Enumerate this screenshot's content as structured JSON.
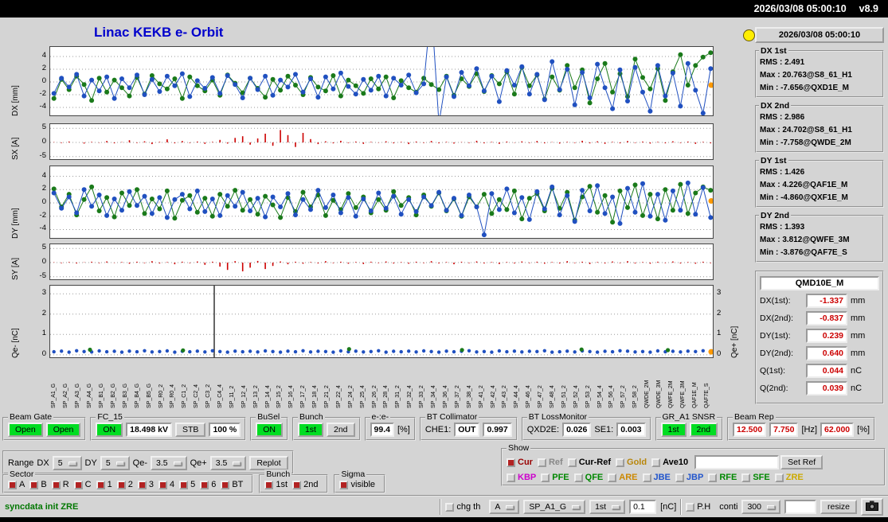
{
  "topbar": {
    "datetime": "2026/03/08 05:00:10",
    "version": "v8.9"
  },
  "header": {
    "title": "Linac KEKB e- Orbit",
    "timestamp": "2026/03/08 05:00:10",
    "lamp_color": "#ffee00"
  },
  "stats_boxes": [
    {
      "title": "DX 1st",
      "lines": [
        "RMS : 2.491",
        "Max : 20.763@S8_61_H1",
        "Min : -7.656@QXD1E_M"
      ]
    },
    {
      "title": "DX 2nd",
      "lines": [
        "RMS : 2.986",
        "Max : 24.702@S8_61_H1",
        "Min : -7.758@QWDE_2M"
      ]
    },
    {
      "title": "DY 1st",
      "lines": [
        "RMS : 1.426",
        "Max : 4.226@QAF1E_M",
        "Min : -4.860@QXF1E_M"
      ]
    },
    {
      "title": "DY 2nd",
      "lines": [
        "RMS : 1.393",
        "Max : 3.812@QWFE_3M",
        "Min : -3.876@QAF7E_S"
      ]
    }
  ],
  "monitor_panel": {
    "title": "QMD10E_M",
    "rows": [
      {
        "label": "DX(1st):",
        "value": "-1.337",
        "unit": "mm"
      },
      {
        "label": "DX(2nd):",
        "value": "-0.837",
        "unit": "mm"
      },
      {
        "label": "DY(1st):",
        "value": "0.239",
        "unit": "mm"
      },
      {
        "label": "DY(2nd):",
        "value": "0.640",
        "unit": "mm"
      },
      {
        "label": "Q(1st):",
        "value": "0.044",
        "unit": "nC"
      },
      {
        "label": "Q(2nd):",
        "value": "0.039",
        "unit": "nC"
      }
    ]
  },
  "panels": {
    "beam_gate": {
      "title": "Beam Gate",
      "open1": "Open",
      "open2": "Open"
    },
    "fc15": {
      "title": "FC_15",
      "on": "ON",
      "kv": "18.498 kV",
      "stb": "STB",
      "pct": "100 %"
    },
    "busel": {
      "title": "BuSel",
      "on": "ON"
    },
    "bunch": {
      "title": "Bunch",
      "b1": "1st",
      "b2": "2nd"
    },
    "ee": {
      "title": "e-:e-",
      "value": "99.4",
      "unit": "[%]"
    },
    "bt_collimator": {
      "title": "BT Collimator",
      "che1_label": "CHE1:",
      "che1": "OUT",
      "value": "0.997"
    },
    "bt_lossmonitor": {
      "title": "BT LossMonitor",
      "qxd2e_label": "QXD2E:",
      "qxd2e": "0.026",
      "se1_label": "SE1:",
      "se1": "0.003"
    },
    "gr_snsr": {
      "title": "GR_A1 SNSR",
      "b1": "1st",
      "b2": "2nd"
    },
    "beam_rep": {
      "title": "Beam Rep",
      "v1": "12.500",
      "v2": "7.750",
      "hz": "[Hz]",
      "v3": "62.000",
      "pct": "[%]"
    }
  },
  "range_row": {
    "label": "Range",
    "dx_label": "DX",
    "dx": "5",
    "dy_label": "DY",
    "dy": "5",
    "qem_label": "Qe-",
    "qem": "3.5",
    "qep_label": "Qe+",
    "qep": "3.5",
    "replot": "Replot"
  },
  "show_panel": {
    "title": "Show",
    "row1": [
      {
        "label": "Cur",
        "checked": true,
        "color": "#990000"
      },
      {
        "label": "Ref",
        "checked": false,
        "color": "#888888"
      },
      {
        "label": "Cur-Ref",
        "checked": false,
        "color": "#000000"
      },
      {
        "label": "Gold",
        "checked": false,
        "color": "#b8860b"
      },
      {
        "label": "Ave10",
        "checked": false,
        "color": "#000000"
      }
    ],
    "set_ref": "Set Ref",
    "row2": [
      {
        "label": "KBP",
        "checked": false,
        "color": "#cc00cc"
      },
      {
        "label": "PFE",
        "checked": false,
        "color": "#008800"
      },
      {
        "label": "QFE",
        "checked": false,
        "color": "#008800"
      },
      {
        "label": "ARE",
        "checked": false,
        "color": "#cc8800"
      },
      {
        "label": "JBE",
        "checked": false,
        "color": "#2255cc"
      },
      {
        "label": "JBP",
        "checked": false,
        "color": "#2255cc"
      },
      {
        "label": "RFE",
        "checked": false,
        "color": "#008800"
      },
      {
        "label": "SFE",
        "checked": false,
        "color": "#008800"
      },
      {
        "label": "ZRE",
        "checked": false,
        "color": "#ccaa00"
      }
    ]
  },
  "sector_panel": {
    "title": "Sector",
    "items": [
      "A",
      "B",
      "R",
      "C",
      "1",
      "2",
      "3",
      "4",
      "5",
      "6",
      "BT"
    ]
  },
  "bunch_panel": {
    "title": "Bunch",
    "items": [
      "1st",
      "2nd"
    ]
  },
  "sigma_panel": {
    "title": "Sigma",
    "items": [
      "visible"
    ]
  },
  "statusbar": {
    "message": "syncdata init ZRE",
    "chg_th": "chg th",
    "dd1": "A",
    "dd2": "SP_A1_G",
    "dd3": "1st",
    "threshold": "0.1",
    "unit": "[nC]",
    "ph": "P.H",
    "conti": "conti",
    "dd4": "300",
    "resize": "resize"
  },
  "xaxis_labels": [
    "SP_A1_G",
    "SP_A2_G",
    "SP_A3_G",
    "SP_A4_G",
    "SP_B1_G",
    "SP_B2_G",
    "SP_B3_G",
    "SP_B4_G",
    "SP_B5_G",
    "SP_R0_2",
    "SP_R0_4",
    "SP_C1_2",
    "SP_C2_4",
    "SP_C3_2",
    "SP_C4_4",
    "SP_11_2",
    "SP_12_4",
    "SP_13_2",
    "SP_14_4",
    "SP_15_2",
    "SP_16_4",
    "SP_17_2",
    "SP_18_4",
    "SP_21_2",
    "SP_22_4",
    "SP_24_2",
    "SP_25_4",
    "SP_26_2",
    "SP_28_4",
    "SP_31_2",
    "SP_32_4",
    "SP_33_2",
    "SP_34_4",
    "SP_36_4",
    "SP_37_2",
    "SP_38_4",
    "SP_41_2",
    "SP_42_4",
    "SP_43_2",
    "SP_44_4",
    "SP_46_4",
    "SP_47_2",
    "SP_48_4",
    "SP_51_2",
    "SP_52_4",
    "SP_53_2",
    "SP_54_4",
    "SP_56_4",
    "SP_57_2",
    "SP_58_2",
    "QWDE_2M",
    "QWDE_3M",
    "QWFE_2M",
    "QWFE_3M",
    "QAF1E_M",
    "QAF7E_S"
  ],
  "chart_data": [
    {
      "id": "dx",
      "type": "scatter-line",
      "ylabel": "DX [mm]",
      "ylim": [
        -5.5,
        5.5
      ],
      "yticks": [
        4,
        2,
        0,
        -2,
        -4
      ],
      "end_marker": -0.5,
      "series": [
        {
          "name": "DX 1st",
          "color": "#1a7a1a",
          "values": [
            -2.6,
            0.4,
            -1.2,
            0.9,
            -0.4,
            -2.9,
            0.6,
            -1.6,
            0.3,
            -0.9,
            -2.2,
            0.7,
            -1.9,
            1.0,
            -0.3,
            -1.1,
            0.5,
            -2.6,
            0.8,
            -0.6,
            -1.4,
            0.3,
            -2.1,
            1.1,
            -0.2,
            -1.7,
            0.6,
            -1.0,
            -2.4,
            0.4,
            -1.3,
            0.9,
            -0.5,
            -2.0,
            0.7,
            -0.8,
            -1.4,
            1.0,
            -2.2,
            0.3,
            -0.6,
            -1.8,
            0.5,
            -1.1,
            0.8,
            -2.5,
            0.2,
            -0.9,
            -1.6,
            0.6,
            -0.4,
            -1.2,
            0.9,
            -2.1,
            0.5,
            -0.7,
            1.3,
            -1.5,
            1.0,
            -0.3,
            1.6,
            -1.9,
            2.3,
            -0.6,
            1.1,
            -2.7,
            0.8,
            -1.3,
            2.6,
            -0.9,
            1.9,
            -3.3,
            0.5,
            2.9,
            -1.6,
            1.3,
            -2.3,
            3.6,
            0.7,
            -1.1,
            2.1,
            -2.9,
            1.6,
            4.3,
            -0.5,
            2.6,
            3.9,
            4.6
          ]
        },
        {
          "name": "DX 2nd",
          "color": "#2050c0",
          "values": [
            -1.8,
            0.6,
            -0.8,
            1.2,
            -2.2,
            0.3,
            -1.4,
            0.8,
            -2.6,
            0.5,
            -0.9,
            1.1,
            -2.0,
            0.4,
            -1.5,
            0.9,
            -0.6,
            1.3,
            -2.3,
            0.2,
            -1.0,
            0.7,
            -1.8,
            1.0,
            -0.4,
            -2.5,
            0.6,
            -1.2,
            0.9,
            -2.1,
            0.3,
            -0.8,
            1.2,
            -1.6,
            0.5,
            -2.4,
            0.8,
            -1.1,
            1.4,
            -0.7,
            -1.9,
            0.4,
            -1.3,
            0.9,
            -2.2,
            0.6,
            -0.5,
            1.1,
            -1.7,
            -0.3,
            12.0,
            -6.5,
            0.8,
            -2.3,
            1.5,
            -0.6,
            2.1,
            -1.4,
            0.9,
            -3.1,
            1.8,
            -0.5,
            2.4,
            -1.9,
            1.2,
            -2.8,
            3.2,
            -1.2,
            2.0,
            -3.6,
            1.5,
            -2.5,
            2.8,
            -0.9,
            -4.2,
            1.9,
            -3.0,
            2.3,
            -1.6,
            -4.6,
            2.6,
            -2.2,
            1.4,
            -3.8,
            2.9,
            -1.3,
            -4.9,
            2.1
          ]
        }
      ]
    },
    {
      "id": "sx",
      "type": "bar",
      "ylabel": "SX [A]",
      "ylim": [
        -6.5,
        6.5
      ],
      "yticks": [
        5,
        0,
        -5
      ],
      "series": [
        {
          "name": "SX",
          "color": "#cc0000",
          "values": [
            0.1,
            -0.2,
            0.3,
            0.0,
            -0.4,
            0.2,
            -0.1,
            0.5,
            -0.3,
            0.1,
            0.8,
            -0.2,
            0.4,
            -0.6,
            0.2,
            1.1,
            -0.3,
            0.5,
            -0.2,
            0.3,
            -0.5,
            0.2,
            0.9,
            -0.4,
            1.6,
            2.2,
            -0.8,
            1.4,
            3.1,
            -1.2,
            4.4,
            2.6,
            -1.6,
            3.4,
            1.2,
            -0.6,
            0.4,
            -0.3,
            0.6,
            -0.2,
            0.3,
            -0.5,
            0.2,
            -0.1,
            0.4,
            -0.3,
            0.2,
            -0.6,
            0.3,
            -0.2,
            0.5,
            -0.3,
            0.2,
            -0.4,
            0.1,
            -0.2,
            0.6,
            -0.3,
            0.2,
            -0.5,
            0.3,
            -0.1,
            0.4,
            -0.2,
            0.5,
            -0.3,
            0.1,
            -0.4,
            0.2,
            -0.2,
            0.6,
            -0.3,
            0.4,
            -0.5,
            0.2,
            -0.3,
            0.5,
            -0.2,
            0.3,
            -0.4,
            0.2,
            -0.3,
            0.4,
            -0.2,
            0.3,
            -0.5,
            0.2,
            -0.3
          ]
        }
      ]
    },
    {
      "id": "dy",
      "type": "scatter-line",
      "ylabel": "DY [mm]",
      "ylim": [
        -5.5,
        5.5
      ],
      "yticks": [
        4,
        2,
        0,
        -2,
        -4
      ],
      "end_marker": 0.3,
      "series": [
        {
          "name": "DY 1st",
          "color": "#1a7a1a",
          "values": [
            2.1,
            -0.6,
            1.3,
            -1.8,
            0.5,
            2.4,
            -1.2,
            0.8,
            -2.1,
            1.5,
            -0.4,
            2.0,
            -1.6,
            0.6,
            -0.9,
            1.8,
            -2.3,
            0.4,
            1.1,
            -1.4,
            0.7,
            -2.0,
            1.3,
            -0.5,
            1.9,
            -1.1,
            0.5,
            -1.7,
            1.0,
            -0.3,
            -2.2,
            0.8,
            -1.3,
            1.6,
            -0.6,
            1.2,
            -1.9,
            0.4,
            -1.0,
            1.4,
            -0.7,
            0.9,
            -1.5,
            0.5,
            -1.1,
            1.7,
            -0.4,
            0.8,
            -1.8,
            1.2,
            -0.5,
            1.5,
            -1.2,
            0.6,
            -2.0,
            0.9,
            -0.6,
            1.3,
            -1.6,
            0.5,
            -1.0,
            1.8,
            -2.4,
            0.7,
            1.4,
            -1.2,
            2.2,
            -0.8,
            1.6,
            -2.6,
            0.9,
            2.5,
            -1.4,
            1.1,
            -2.9,
            1.8,
            -0.7,
            2.7,
            -1.9,
            1.3,
            -2.4,
            2.0,
            -1.1,
            2.8,
            -1.6,
            1.5,
            2.4,
            1.9
          ]
        },
        {
          "name": "DY 2nd",
          "color": "#2050c0",
          "values": [
            1.5,
            -0.8,
            0.9,
            -1.5,
            2.0,
            -0.5,
            1.2,
            -1.9,
            0.6,
            -1.1,
            1.7,
            -0.4,
            1.0,
            -1.6,
            0.8,
            -2.2,
            0.5,
            1.3,
            -0.9,
            1.8,
            -1.3,
            0.6,
            -1.9,
            1.1,
            -0.5,
            1.6,
            -1.2,
            0.7,
            -2.1,
            0.9,
            -0.6,
            1.4,
            -1.8,
            0.5,
            -1.0,
            1.9,
            -0.7,
            1.2,
            -1.5,
            0.8,
            -2.0,
            0.6,
            -1.2,
            1.5,
            -0.8,
            1.0,
            -1.7,
            0.5,
            -1.3,
            0.9,
            -0.4,
            1.6,
            -1.1,
            0.7,
            -1.9,
            1.2,
            -0.6,
            -4.8,
            1.4,
            -1.0,
            2.1,
            -1.5,
            0.8,
            -2.5,
            1.7,
            -0.9,
            2.4,
            -1.8,
            1.1,
            -2.8,
            1.9,
            -1.2,
            2.6,
            -1.6,
            0.9,
            -3.1,
            2.2,
            -1.4,
            2.9,
            -2.0,
            1.3,
            -2.6,
            1.8,
            -1.1,
            3.0,
            -1.7,
            2.3,
            -2.2
          ]
        }
      ]
    },
    {
      "id": "sy",
      "type": "bar",
      "ylabel": "SY [A]",
      "ylim": [
        -6.5,
        6.5
      ],
      "yticks": [
        5,
        0,
        -5
      ],
      "series": [
        {
          "name": "SY",
          "color": "#cc0000",
          "values": [
            0.1,
            -0.2,
            0.2,
            -0.3,
            0.1,
            0.3,
            -0.2,
            0.4,
            -0.1,
            0.2,
            -0.4,
            0.3,
            -0.2,
            0.5,
            -0.3,
            0.2,
            -0.6,
            0.3,
            -0.2,
            0.4,
            -0.8,
            0.3,
            -1.4,
            -2.6,
            0.5,
            -3.1,
            -1.8,
            0.6,
            -2.3,
            -1.2,
            0.4,
            -0.6,
            0.3,
            -0.4,
            0.2,
            -0.3,
            0.5,
            -0.2,
            0.3,
            -0.4,
            0.2,
            -0.5,
            0.3,
            -0.2,
            0.4,
            -0.3,
            0.2,
            -0.4,
            0.3,
            -0.2,
            0.5,
            -0.3,
            0.2,
            -0.6,
            0.3,
            -0.2,
            0.4,
            -0.3,
            0.2,
            -0.5,
            0.2,
            -0.3,
            0.4,
            -0.2,
            0.3,
            -0.4,
            0.2,
            -0.3,
            0.5,
            -0.2,
            0.3,
            -0.5,
            0.2,
            -0.3,
            0.4,
            -0.2,
            0.5,
            -0.3,
            0.2,
            -0.4,
            0.3,
            -0.2,
            0.4,
            -0.3,
            0.2,
            -0.4,
            0.3,
            -0.2
          ]
        }
      ]
    },
    {
      "id": "q",
      "type": "scatter",
      "ylabel": "Qe- [nC]",
      "ylabel_right": "Qe+ [nC]",
      "ylim": [
        -0.2,
        3.4
      ],
      "yticks": [
        3,
        2,
        1,
        0
      ],
      "right_yticks": [
        3,
        2,
        1,
        0
      ],
      "vlines": [
        0.247
      ],
      "end_marker": 0.15,
      "points_color": "#1a7a1a",
      "points": [
        [
          0.06,
          0.25
        ],
        [
          0.2,
          0.22
        ],
        [
          0.45,
          0.28
        ],
        [
          0.62,
          0.24
        ],
        [
          0.8,
          0.26
        ],
        [
          0.93,
          0.23
        ]
      ],
      "series": [
        {
          "name": "Qe-",
          "color": "#2050c0",
          "values": [
            0.15,
            0.18,
            0.13,
            0.2,
            0.16,
            0.14,
            0.19,
            0.15,
            0.17,
            0.13,
            0.18,
            0.15,
            0.2,
            0.14,
            0.16,
            0.19,
            0.13,
            0.17,
            0.15,
            0.18,
            0.14,
            0.2,
            0.16,
            0.13,
            0.18,
            0.15,
            0.17,
            0.14,
            0.19,
            0.16,
            0.13,
            0.18,
            0.15,
            0.2,
            0.14,
            0.17,
            0.16,
            0.13,
            0.19,
            0.15,
            0.18,
            0.14,
            0.16,
            0.2,
            0.13,
            0.17,
            0.15,
            0.18,
            0.14,
            0.19,
            0.16,
            0.13,
            0.18,
            0.15,
            0.17,
            0.2,
            0.14,
            0.16,
            0.13,
            0.19,
            0.15,
            0.18,
            0.14,
            0.17,
            0.16,
            0.2,
            0.13,
            0.15,
            0.18,
            0.14,
            0.19,
            0.16,
            0.13,
            0.17,
            0.15,
            0.2,
            0.18,
            0.14,
            0.16,
            0.13,
            0.19,
            0.15,
            0.17,
            0.14,
            0.18,
            0.16,
            0.2,
            0.15
          ]
        }
      ]
    }
  ]
}
